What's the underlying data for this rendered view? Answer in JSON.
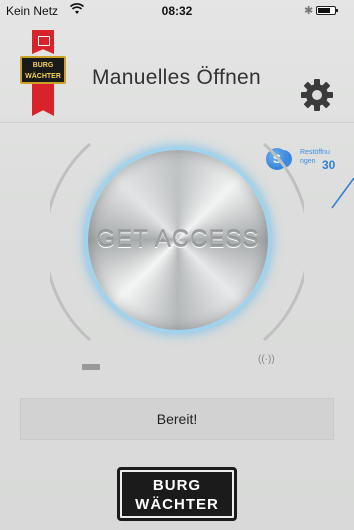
{
  "status_bar": {
    "carrier": "Kein Netz",
    "time": "08:32",
    "bluetooth": "✱"
  },
  "header": {
    "logo_small": "BURG\nWÄCHTER",
    "title": "Manuelles Öffnen",
    "settings_icon": "gear-icon"
  },
  "remaining_openings": {
    "icon_symbol": "S",
    "label": "Restöffnu ngen",
    "count": "30"
  },
  "access_button": {
    "label": "GET ACCESS"
  },
  "status_panel": {
    "text": "Bereit!"
  },
  "footer": {
    "brand_line1": "BURG",
    "brand_line2": "WÄCHTER"
  },
  "colors": {
    "accent_blue": "#2f7fd8",
    "glow_blue": "#9fd4f0",
    "brand_red": "#d8232a"
  }
}
